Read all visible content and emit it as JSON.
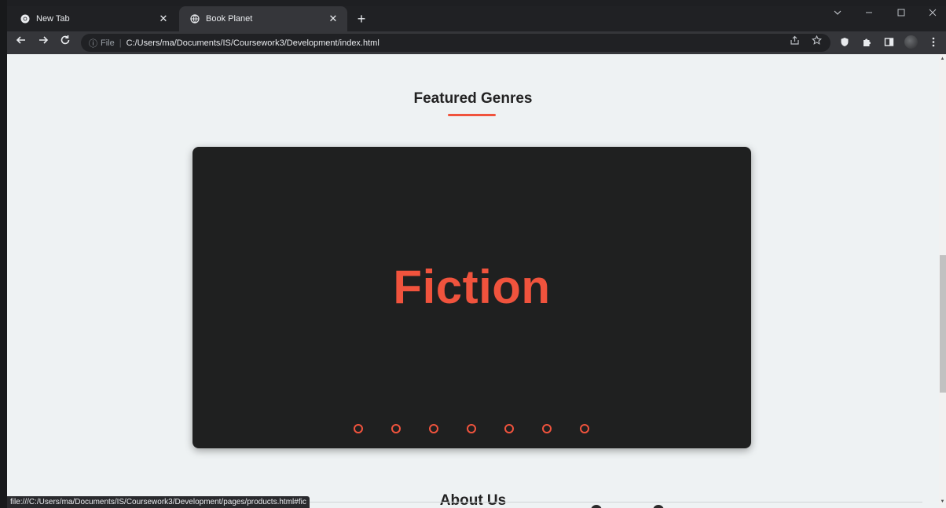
{
  "browser": {
    "tabs": [
      {
        "title": "New Tab",
        "favicon": "chrome-icon",
        "active": false
      },
      {
        "title": "Book Planet",
        "favicon": "globe-icon",
        "active": true
      }
    ],
    "close_glyph": "✕",
    "new_tab_glyph": "+",
    "address": {
      "info_glyph": "ⓘ",
      "scheme_label": "File",
      "separator": "|",
      "url": "C:/Users/ma/Documents/IS/Coursework3/Development/index.html"
    },
    "status_url": "file:///C:/Users/ma/Documents/IS/Coursework3/Development/pages/products.html#fic"
  },
  "page": {
    "featured_title": "Featured Genres",
    "carousel": {
      "current_slide": "Fiction",
      "slide_count": 7,
      "accent_color": "#f0533d",
      "background_color": "#1f2020"
    },
    "about_title": "About Us"
  },
  "colors": {
    "accent": "#f0533d",
    "page_background": "#eef2f3",
    "browser_dark": "#202124"
  }
}
